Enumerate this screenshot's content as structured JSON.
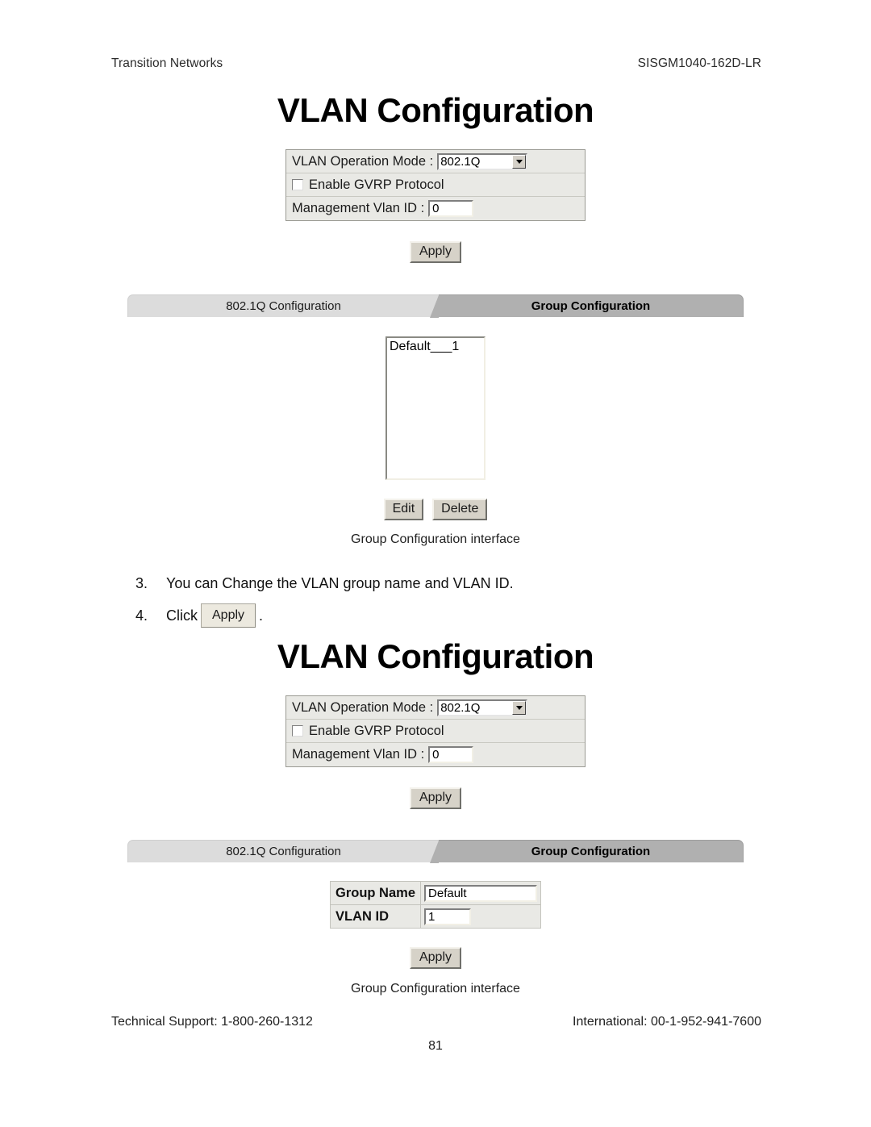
{
  "header": {
    "left": "Transition Networks",
    "right": "SISGM1040-162D-LR"
  },
  "screens": [
    {
      "title": "VLAN Configuration",
      "panel": {
        "operation_mode_label": "VLAN Operation Mode :",
        "operation_mode_value": "802.1Q",
        "gvrp_label": "Enable GVRP Protocol",
        "gvrp_checked": false,
        "mgmt_vlan_label": "Management Vlan ID :",
        "mgmt_vlan_value": "0"
      },
      "apply_label": "Apply",
      "tabs": [
        {
          "label": "802.1Q Configuration",
          "active": false
        },
        {
          "label": "Group Configuration",
          "active": true
        }
      ],
      "listbox": {
        "items": [
          "Default___1"
        ]
      },
      "buttons": {
        "edit": "Edit",
        "delete": "Delete"
      },
      "caption": "Group Configuration interface"
    },
    {
      "title": "VLAN Configuration",
      "panel": {
        "operation_mode_label": "VLAN Operation Mode :",
        "operation_mode_value": "802.1Q",
        "gvrp_label": "Enable GVRP Protocol",
        "gvrp_checked": false,
        "mgmt_vlan_label": "Management Vlan ID :",
        "mgmt_vlan_value": "0"
      },
      "apply_label": "Apply",
      "tabs": [
        {
          "label": "802.1Q Configuration",
          "active": false
        },
        {
          "label": "Group Configuration",
          "active": true
        }
      ],
      "group_form": {
        "rows": [
          {
            "key": "Group Name",
            "value": "Default"
          },
          {
            "key": "VLAN ID",
            "value": "1"
          }
        ],
        "apply_label": "Apply"
      },
      "caption": "Group Configuration interface"
    }
  ],
  "steps": [
    {
      "num": "3.",
      "text": "You can Change the VLAN group name and VLAN ID."
    },
    {
      "num": "4.",
      "text_before": "Click",
      "button_label": "Apply",
      "text_after": "."
    }
  ],
  "footer": {
    "tech_support": "Technical Support: 1-800-260-1312",
    "international": "International: 00-1-952-941-7600",
    "page_number": "81"
  }
}
